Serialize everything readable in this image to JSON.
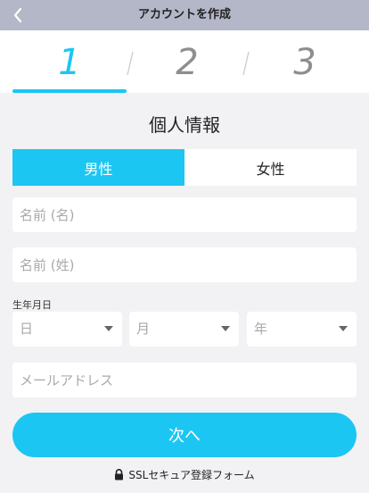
{
  "header": {
    "title": "アカウントを作成",
    "back_icon": "chevron-left-icon"
  },
  "steps": {
    "items": [
      "1",
      "2",
      "3"
    ],
    "active": 1
  },
  "form": {
    "section_title": "個人情報",
    "gender": {
      "options": [
        "男性",
        "女性"
      ],
      "selected": "男性"
    },
    "first_name": {
      "placeholder": "名前 (名)",
      "value": ""
    },
    "last_name": {
      "placeholder": "名前 (姓)",
      "value": ""
    },
    "dob": {
      "label": "生年月日",
      "day": "日",
      "month": "月",
      "year": "年"
    },
    "email": {
      "placeholder": "メールアドレス",
      "value": ""
    },
    "next_label": "次へ",
    "ssl_text": "SSLセキュア登録フォーム"
  },
  "colors": {
    "accent": "#1cc6f3",
    "header_bg": "#b3b7c8",
    "page_bg": "#f2f2f4",
    "step_inactive": "#8e8e8e"
  }
}
